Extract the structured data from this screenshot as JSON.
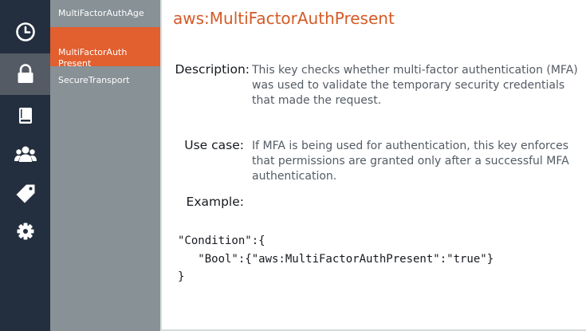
{
  "rail": {
    "items": [
      {
        "icon": "clock-icon"
      },
      {
        "icon": "lock-icon",
        "active": true
      },
      {
        "icon": "book-icon"
      },
      {
        "icon": "users-icon"
      },
      {
        "icon": "tag-icon"
      },
      {
        "icon": "gear-icon"
      }
    ]
  },
  "submenu": {
    "items": [
      {
        "label": "MultiFactorAuthAge"
      },
      {
        "label": "MultiFactorAuth\nPresent",
        "active": true
      },
      {
        "label": "SecureTransport"
      }
    ]
  },
  "main": {
    "title": "aws:MultiFactorAuthPresent",
    "description_label": "Description:",
    "description_text": "This key checks whether multi-factor authentication (MFA) was used to validate the temporary security credentials that made the request.",
    "use_case_label": "Use case:",
    "use_case_text": "If MFA is being used for authentication, this key enforces that permissions are granted only after a successful MFA authentication.",
    "example_label": "Example:",
    "code_line1": "\"Condition\":{",
    "code_line2": "   \"Bool\":{\"aws:MultiFactorAuthPresent\":\"true\"}",
    "code_line3": "}"
  },
  "colors": {
    "rail_bg": "#232f3e",
    "rail_active": "#545b64",
    "submenu_bg": "#879196",
    "accent": "#e25f2f",
    "title": "#d45b27"
  }
}
